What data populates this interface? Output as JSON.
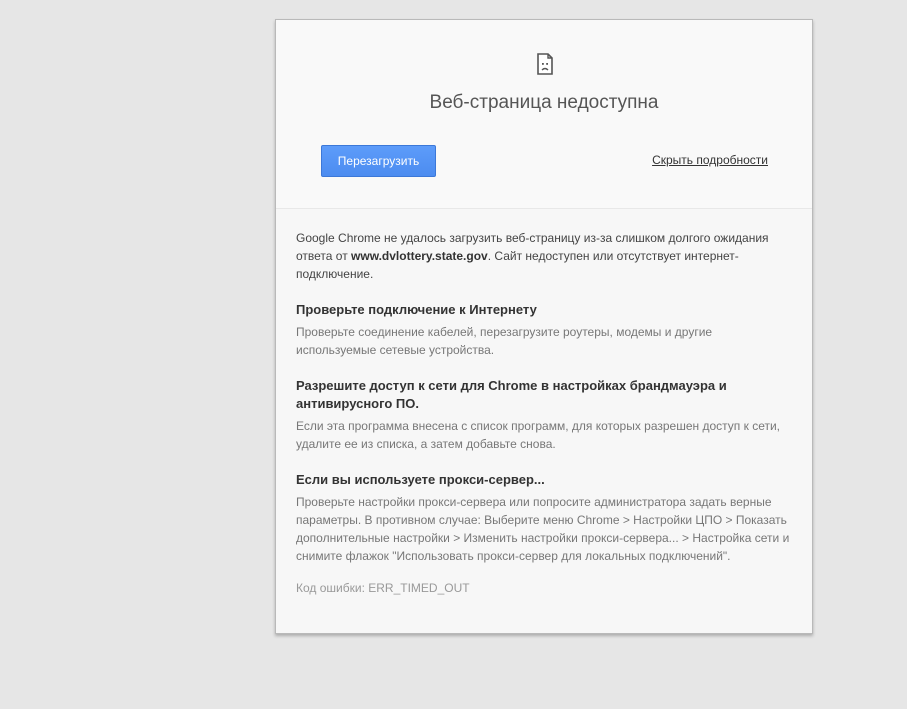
{
  "page": {
    "title": "Веб-страница недоступна",
    "icon": "sad-page-icon"
  },
  "actions": {
    "reload_label": "Перезагрузить",
    "hide_details_label": "Скрыть подробности"
  },
  "intro": {
    "before": "Google Chrome не удалось загрузить веб-страницу из-за слишком долгого ожидания ответа от ",
    "host": "www.dvlottery.state.gov",
    "after": ". Сайт недоступен или отсутствует интернет-подключение."
  },
  "sections": [
    {
      "title": "Проверьте подключение к Интернету",
      "text": "Проверьте соединение кабелей, перезагрузите роутеры, модемы и другие используемые сетевые устройства."
    },
    {
      "title": "Разрешите доступ к сети для Chrome в настройках брандмауэра и антивирусного ПО.",
      "text": "Если эта программа внесена с список программ, для которых разрешен доступ к сети, удалите ее из списка, а затем добавьте снова."
    },
    {
      "title": "Если вы используете прокси-сервер...",
      "text": "Проверьте настройки прокси-сервера или попросите администратора задать верные параметры. В противном случае: Выберите меню Chrome > Настройки ЦПО > Показать дополнительные настройки > Изменить настройки прокси-сервера... > Настройка сети и снимите флажок \"Использовать прокси-сервер для локальных подключений\"."
    }
  ],
  "error_code": "Код ошибки: ERR_TIMED_OUT",
  "colors": {
    "background": "#e6e6e6",
    "card": "#f7f7f7",
    "button": "#4d90fe"
  }
}
